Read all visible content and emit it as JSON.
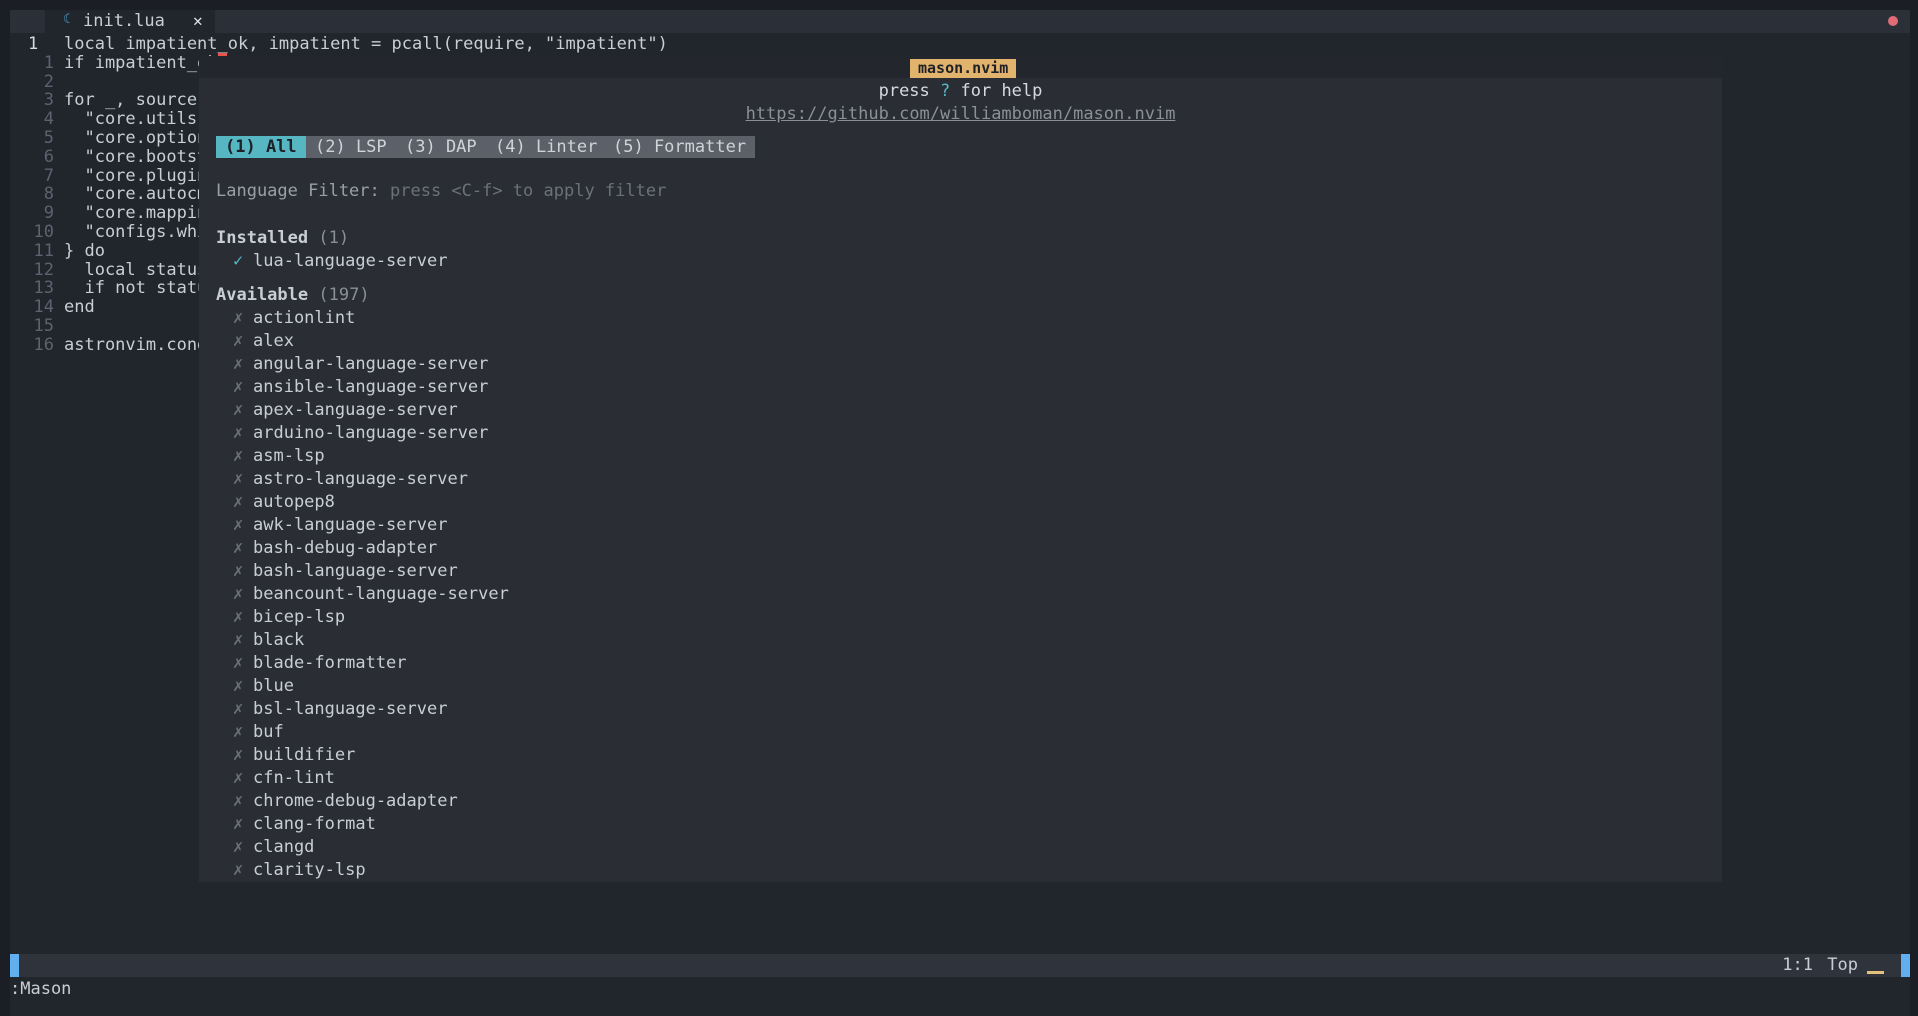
{
  "tab": {
    "filename": "init.lua",
    "file_icon": "lua-file-icon",
    "close_glyph": "✕"
  },
  "editor": {
    "lines": [
      {
        "num": "1",
        "text": "local impatient_ok, impatient = pcall(require, \"impatient\")",
        "current": true
      },
      {
        "num": "1",
        "text": "if impatient_ok",
        "cursor": true
      },
      {
        "num": "2",
        "text": ""
      },
      {
        "num": "3",
        "text": "for _, source i"
      },
      {
        "num": "4",
        "text": "  \"core.utils\","
      },
      {
        "num": "5",
        "text": "  \"core.options"
      },
      {
        "num": "6",
        "text": "  \"core.bootstr"
      },
      {
        "num": "7",
        "text": "  \"core.plugins"
      },
      {
        "num": "8",
        "text": "  \"core.autocmd"
      },
      {
        "num": "9",
        "text": "  \"core.mapping"
      },
      {
        "num": "10",
        "text": "  \"configs.whic"
      },
      {
        "num": "11",
        "text": "} do"
      },
      {
        "num": "12",
        "text": "  local status_"
      },
      {
        "num": "13",
        "text": "  if not status"
      },
      {
        "num": "14",
        "text": "end"
      },
      {
        "num": "15",
        "text": ""
      },
      {
        "num": "16",
        "text": "astronvim.condi"
      }
    ]
  },
  "mason": {
    "title": "mason.nvim",
    "help_pre": "press ",
    "help_key": "?",
    "help_post": " for help",
    "url": "https://github.com/williamboman/mason.nvim",
    "tabs": [
      {
        "label": "(1) All",
        "active": true
      },
      {
        "label": "(2) LSP",
        "active": false
      },
      {
        "label": "(3) DAP",
        "active": false
      },
      {
        "label": "(4) Linter",
        "active": false
      },
      {
        "label": "(5) Formatter",
        "active": false
      }
    ],
    "filter_label": "Language Filter: ",
    "filter_hint": "press <C-f> to apply filter",
    "installed": {
      "heading": "Installed",
      "count": "(1)",
      "items": [
        "lua-language-server"
      ],
      "mark": "✓"
    },
    "available": {
      "heading": "Available",
      "count": "(197)",
      "mark": "✗",
      "items": [
        "actionlint",
        "alex",
        "angular-language-server",
        "ansible-language-server",
        "apex-language-server",
        "arduino-language-server",
        "asm-lsp",
        "astro-language-server",
        "autopep8",
        "awk-language-server",
        "bash-debug-adapter",
        "bash-language-server",
        "beancount-language-server",
        "bicep-lsp",
        "black",
        "blade-formatter",
        "blue",
        "bsl-language-server",
        "buf",
        "buildifier",
        "cfn-lint",
        "chrome-debug-adapter",
        "clang-format",
        "clangd",
        "clarity-lsp"
      ]
    }
  },
  "statusline": {
    "position": "1:1",
    "scroll": "Top"
  },
  "cmdline": ":Mason",
  "colors": {
    "accent_cyan": "#56b6c2",
    "title_orange": "#e2b36c",
    "mode_blue": "#61afef",
    "cursor_red": "#e8544c"
  }
}
